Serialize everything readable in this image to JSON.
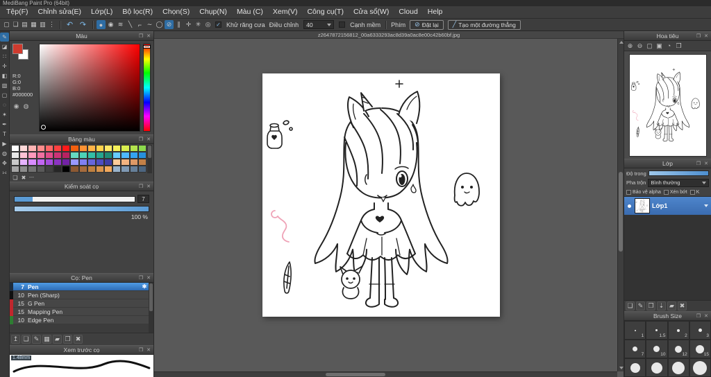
{
  "titlebar": {
    "title": "MediBang Paint Pro (64bit)"
  },
  "menubar": {
    "items": [
      "Tệp(F)",
      "Chỉnh sửa(E)",
      "Lớp(L)",
      "Bộ lọc(R)",
      "Chọn(S)",
      "Chụp(N)",
      "Màu (C)",
      "Xem(V)",
      "Công cụ(T)",
      "Cửa sổ(W)",
      "Cloud",
      "Help"
    ]
  },
  "toolbar": {
    "file_icons": [
      {
        "name": "new-canvas-icon",
        "glyph": "▢"
      },
      {
        "name": "comment-icon",
        "glyph": "❏"
      },
      {
        "name": "open-icon",
        "glyph": "▤"
      },
      {
        "name": "save-icon",
        "glyph": "▦"
      },
      {
        "name": "gallery-icon",
        "glyph": "▥"
      },
      {
        "name": "more-icon",
        "glyph": "⋮"
      }
    ],
    "undo_glyph": "↶",
    "redo_glyph": "↷",
    "tool_icons": [
      {
        "name": "brush-mode-icon",
        "glyph": "●",
        "bg": "#2e6da4"
      },
      {
        "name": "soft-brush-icon",
        "glyph": "◉"
      },
      {
        "name": "stabilizer-icon",
        "glyph": "≋"
      },
      {
        "name": "line-tool-icon",
        "glyph": "╲"
      },
      {
        "name": "polyline-tool-icon",
        "glyph": "⌐"
      },
      {
        "name": "curve-tool-icon",
        "glyph": "∼"
      },
      {
        "name": "ellipse-tool-icon",
        "glyph": "◯"
      },
      {
        "name": "snap-off-icon",
        "glyph": "⊘",
        "bg": "#2e6da4"
      },
      {
        "name": "snap-parallel-icon",
        "glyph": "∥"
      },
      {
        "name": "snap-cross-icon",
        "glyph": "✛"
      },
      {
        "name": "snap-vanish-icon",
        "glyph": "✳"
      },
      {
        "name": "snap-circle-icon",
        "glyph": "◎"
      }
    ],
    "antialias_label": "Khử răng cưa",
    "check_glyph": "✓",
    "correction_label": "Điều chỉnh",
    "correction_value": "40",
    "soft_edge_label": "Cạnh mềm",
    "key_label": "Phím",
    "reset_icon": "⊘",
    "reset_label": "Đặt lại",
    "line_icon": "╱",
    "line_label": "Tạo một đường thẳng"
  },
  "panel": {
    "float_icon": "❐",
    "close_icon": "✕"
  },
  "toolstrip": {
    "tools": [
      {
        "name": "brush-tool-icon",
        "glyph": "✎",
        "bg": "#2e6da4"
      },
      {
        "name": "eraser-tool-icon",
        "glyph": "◪"
      },
      {
        "name": "blur-tool-icon",
        "glyph": "∷"
      },
      {
        "name": "move-tool-icon",
        "glyph": "✛"
      },
      {
        "name": "fill-tool-icon",
        "glyph": "◧"
      },
      {
        "name": "gradient-tool-icon",
        "glyph": "▧"
      },
      {
        "name": "select-tool-icon",
        "glyph": "▢"
      },
      {
        "name": "lasso-tool-icon",
        "glyph": "◌"
      },
      {
        "name": "magic-wand-tool-icon",
        "glyph": "✶"
      },
      {
        "name": "select-pen-tool-icon",
        "glyph": "✒"
      },
      {
        "name": "text-tool-icon",
        "glyph": "T"
      },
      {
        "name": "operation-tool-icon",
        "glyph": "▶"
      },
      {
        "name": "eyedropper-tool-icon",
        "glyph": "◍"
      },
      {
        "name": "hand-tool-icon",
        "glyph": "✥"
      },
      {
        "name": "divide-tool-icon",
        "glyph": "∺"
      }
    ]
  },
  "color_panel": {
    "title": "Màu",
    "r_label": "R:0",
    "g_label": "G:0",
    "b_label": "B:0",
    "hex_value": "#000000",
    "fg_color": "#cf3b2e",
    "bg_color": "#ffffff",
    "set_icons": [
      {
        "name": "color-set-icon",
        "glyph": "◉"
      },
      {
        "name": "color-wheel-icon",
        "glyph": "◍"
      }
    ]
  },
  "palette_panel": {
    "title": "Bảng màu",
    "footer_label": "---",
    "footer_icons": [
      {
        "name": "add-color-icon",
        "glyph": "❏"
      },
      {
        "name": "delete-color-icon",
        "glyph": "✖"
      }
    ],
    "colors": [
      "#ffffff",
      "#ffd9d9",
      "#ffb3b3",
      "#ff8c8c",
      "#ff6666",
      "#ff4040",
      "#ff1a1a",
      "#f2600f",
      "#ff9233",
      "#ffb347",
      "#ffd24d",
      "#ffe866",
      "#f5f05a",
      "#d9ee4f",
      "#b3e34d",
      "#8cd94d",
      "#e8e8e8",
      "#ffc2d4",
      "#ff99bb",
      "#f070a0",
      "#e04c8a",
      "#cc3377",
      "#b82262",
      "#66d9c2",
      "#4dd2b8",
      "#33bfa6",
      "#26a68f",
      "#1f8c77",
      "#66ccff",
      "#4db8ff",
      "#33a3f2",
      "#2690dd",
      "#c9c9c9",
      "#e6b3ff",
      "#d98cff",
      "#c266f2",
      "#a64ddd",
      "#8c33c2",
      "#7322a6",
      "#9999ff",
      "#8080f2",
      "#6666dd",
      "#4d4dc2",
      "#3d3da6",
      "#ffcc99",
      "#f2b380",
      "#dd9966",
      "#c28047",
      "#a6a6a6",
      "#8c8c8c",
      "#737373",
      "#595959",
      "#404040",
      "#262626",
      "#000000",
      "#8c5933",
      "#a66b3d",
      "#bf8040",
      "#d9944d",
      "#f2a95c",
      "#99b3cc",
      "#7f99b3",
      "#667f99",
      "#4d6680"
    ]
  },
  "brush_control": {
    "title": "Kiểm soát cọ",
    "size_value": "7",
    "opacity_value": "100 %"
  },
  "brush_panel": {
    "title": "Cọ: Pen",
    "brushes": [
      {
        "size": "7",
        "name": "Pen",
        "chip": "#1f2d3d",
        "cls": "selected",
        "gear": "✱"
      },
      {
        "size": "10",
        "name": "Pen (Sharp)",
        "chip": "#101010"
      },
      {
        "size": "15",
        "name": "G Pen",
        "chip": "#c0272d"
      },
      {
        "size": "15",
        "name": "Mapping Pen",
        "chip": "#c0272d"
      },
      {
        "size": "10",
        "name": "Edge Pen",
        "chip": "#2e7d32"
      }
    ],
    "footer_icons": [
      {
        "name": "brush-sync-icon",
        "glyph": "↥"
      },
      {
        "name": "add-brush-icon",
        "glyph": "❏"
      },
      {
        "name": "edit-brush-icon",
        "glyph": "✎"
      },
      {
        "name": "brush-menu-icon",
        "glyph": "▦"
      },
      {
        "name": "brush-folder-icon",
        "glyph": "▰"
      },
      {
        "name": "duplicate-brush-icon",
        "glyph": "❐"
      },
      {
        "name": "delete-brush-icon",
        "glyph": "✖"
      }
    ]
  },
  "preview_panel": {
    "title": "Xem trước cọ",
    "size_label": "1.48mm"
  },
  "canvas": {
    "tab_title": "z2647872156812_00a6333293ac8d39a0ac8e00c42b60bf.jpg"
  },
  "navigator": {
    "title": "Hoa tiêu",
    "zoom_icons": [
      {
        "name": "zoom-in-icon",
        "glyph": "⊕"
      },
      {
        "name": "zoom-out-icon",
        "glyph": "⊖"
      },
      {
        "name": "zoom-reset-icon",
        "glyph": "▢"
      },
      {
        "name": "zoom-fit-icon",
        "glyph": "▣"
      },
      {
        "name": "rotate-view-icon",
        "glyph": "◔"
      },
      {
        "name": "full-view-icon",
        "glyph": "❒"
      }
    ]
  },
  "layer_panel": {
    "title": "Lớp",
    "opacity_label": "Độ trong",
    "blend_label": "Pha trộn",
    "blend_value": "Bình thường",
    "checkboxes": [
      "Bảo vệ alpha",
      "Xén bớt",
      "K"
    ],
    "layers": [
      {
        "name": "Lớp1",
        "cls": "selected"
      }
    ],
    "footer_icons": [
      {
        "name": "new-layer-icon",
        "glyph": "❏"
      },
      {
        "name": "layer-settings-icon",
        "glyph": "✎"
      },
      {
        "name": "duplicate-layer-icon",
        "glyph": "❐"
      },
      {
        "name": "merge-down-icon",
        "glyph": "⇣"
      },
      {
        "name": "layer-folder-icon",
        "glyph": "▰"
      },
      {
        "name": "delete-layer-icon",
        "glyph": "✖"
      }
    ]
  },
  "brush_size_panel": {
    "title": "Brush Size",
    "sizes": [
      {
        "label": "1",
        "dot": "2px"
      },
      {
        "label": "1.5",
        "dot": "3px"
      },
      {
        "label": "2",
        "dot": "4px"
      },
      {
        "label": "3",
        "dot": "5px"
      },
      {
        "label": "7",
        "dot": "7px"
      },
      {
        "label": "10",
        "dot": "9px"
      },
      {
        "label": "12",
        "dot": "10px"
      },
      {
        "label": "15",
        "dot": "12px"
      },
      {
        "label": "",
        "dot": "14px"
      },
      {
        "label": "",
        "dot": "16px"
      },
      {
        "label": "",
        "dot": "18px"
      },
      {
        "label": "",
        "dot": "20px"
      }
    ]
  }
}
